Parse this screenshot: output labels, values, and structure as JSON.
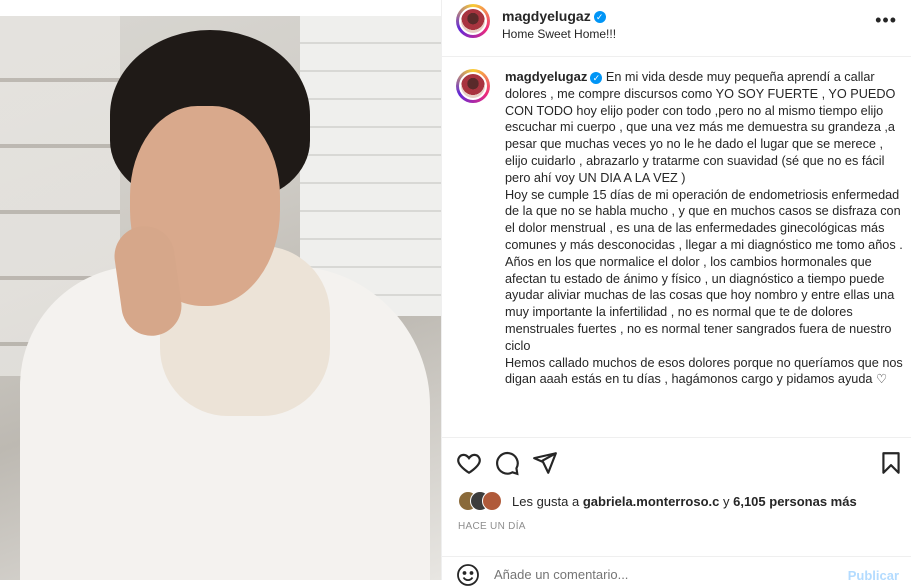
{
  "post": {
    "username": "magdyelugaz",
    "location": "Home Sweet Home!!!",
    "caption": "En mi vida desde muy pequeña aprendí a callar dolores , me compre discursos como YO SOY FUERTE , YO PUEDO CON TODO hoy elijo poder con todo ,pero no al mismo tiempo elijo escuchar mi cuerpo , que una vez más me demuestra su grandeza ,a pesar que muchas veces yo no le he dado el lugar que se merece , elijo cuidarlo , abrazarlo y tratarme con suavidad (sé que no es fácil pero ahí voy UN DIA A LA VEZ )\nHoy se cumple 15 días de mi operación de endometriosis enfermedad de la que no se habla mucho , y que en muchos casos se disfraza con el dolor menstrual , es una de las enfermedades ginecológicas más comunes y más desconocidas , llegar a mi diagnóstico me tomo años .\nAños en los que normalice el dolor , los cambios hormonales que afectan tu estado de ánimo y físico , un diagnóstico a tiempo puede ayudar aliviar muchas de las cosas que hoy nombro y entre ellas una muy importante la infertilidad , no es normal que te de dolores menstruales fuertes , no es normal tener sangrados fuera de nuestro ciclo\nHemos callado muchos de esos dolores porque no queríamos que nos digan aaah estás en tu días , hagámonos cargo y pidamos ayuda ♡",
    "likes_prefix": "Les gusta a ",
    "likes_user": "gabriela.monterroso.c",
    "likes_middle": " y ",
    "likes_count": "6,105 personas más",
    "time_ago": "HACE UN DÍA"
  },
  "comment": {
    "placeholder": "Añade un comentario...",
    "publish_label": "Publicar"
  },
  "icons": [
    "heart-icon",
    "comment-icon",
    "share-icon",
    "bookmark-icon",
    "more-icon",
    "emoji-icon",
    "verified-badge-icon"
  ],
  "colors": {
    "link": "#0095f6",
    "publish_disabled": "#b3dbff",
    "muted": "#8e8e8e"
  }
}
